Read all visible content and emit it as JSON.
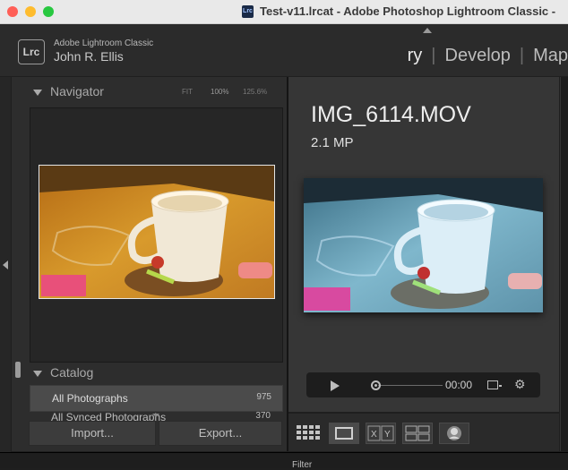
{
  "window": {
    "title": "Test-v11.lrcat - Adobe Photoshop Lightroom Classic -",
    "icon_label": "Lrc"
  },
  "identity_plate": {
    "logo": "Lrc",
    "app_name": "Adobe Lightroom Classic",
    "user_name": "John R. Ellis"
  },
  "modules": [
    {
      "label": "ry",
      "active": true
    },
    {
      "label": "Develop",
      "active": false
    },
    {
      "label": "Map",
      "active": false
    }
  ],
  "navigator": {
    "title": "Navigator",
    "options": [
      "FIT",
      "100%",
      "125.6%"
    ]
  },
  "catalog": {
    "title": "Catalog",
    "items": [
      {
        "label": "All Photographs",
        "count": "975"
      },
      {
        "label": "All Synced Photographs",
        "count": "370"
      }
    ]
  },
  "left_buttons": {
    "import": "Import...",
    "export": "Export..."
  },
  "loupe": {
    "filename": "IMG_6114.MOV",
    "megapixels": "2.1 MP"
  },
  "video": {
    "time": "00:00"
  },
  "filmstrip": {
    "filter_label": "Filter"
  },
  "icons": {
    "play": "play-icon",
    "settings": "gear-icon",
    "grid": "grid-view-icon",
    "loupe": "loupe-view-icon",
    "compare": "compare-view-icon",
    "survey": "survey-view-icon",
    "people": "people-view-icon"
  }
}
